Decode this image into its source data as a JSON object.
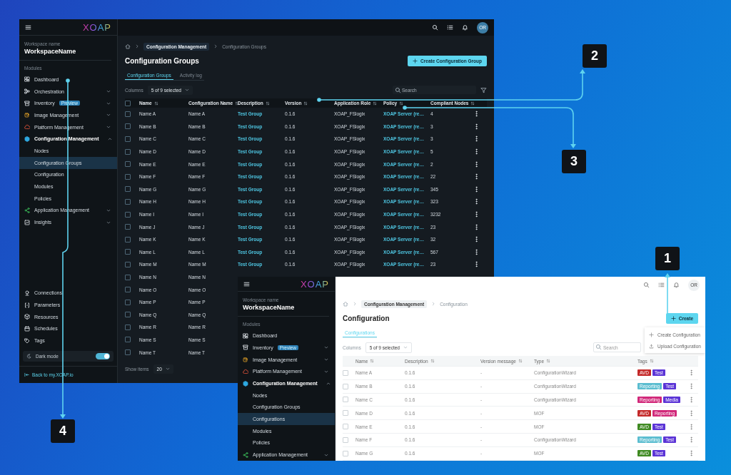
{
  "dark_window": {
    "sidebar": {
      "logo": "XOAP",
      "workspace_label": "Workspace name",
      "workspace_name": "WorkspaceName",
      "modules_label": "Modules",
      "nav": [
        {
          "label": "Dashboard",
          "selected": false
        },
        {
          "label": "Orchestration",
          "selected": false,
          "expanded": false
        },
        {
          "label": "Inventory",
          "selected": false,
          "expanded": false,
          "badge": "Preview"
        },
        {
          "label": "Image Management",
          "selected": false,
          "expanded": false
        },
        {
          "label": "Platform Management",
          "selected": false,
          "expanded": false
        },
        {
          "label": "Configuration Management",
          "selected": false,
          "expanded": true,
          "children": [
            {
              "label": "Nodes",
              "selected": false
            },
            {
              "label": "Configuration Groups",
              "selected": true
            },
            {
              "label": "Configuration",
              "selected": false
            },
            {
              "label": "Modules",
              "selected": false
            },
            {
              "label": "Policies",
              "selected": false
            }
          ]
        },
        {
          "label": "Application Management",
          "selected": false,
          "expanded": false
        },
        {
          "label": "Insights",
          "selected": false,
          "expanded": false
        }
      ],
      "bottom_nav": [
        {
          "label": "Connections"
        },
        {
          "label": "Parameters"
        },
        {
          "label": "Resources"
        },
        {
          "label": "Schedules"
        },
        {
          "label": "Tags"
        }
      ],
      "dark_mode": {
        "label": "Dark mode",
        "on": true
      },
      "back_link": "Back to my.XOAP.io"
    },
    "avatar": "OR",
    "breadcrumb": [
      "Configuration Management",
      "Configuration Groups"
    ],
    "title": "Configuration Groups",
    "create_button": "Create Configuration Group",
    "tabs": [
      {
        "label": "Configuration Groups",
        "selected": true
      },
      {
        "label": "Activity log",
        "selected": false
      }
    ],
    "columns_label": "Columns",
    "columns_select": "5 of 9 selected",
    "search": {
      "placeholder": "Search"
    },
    "select_all_checked": false,
    "columns": [
      "Name",
      "Configuration Name",
      "Description",
      "Version",
      "Application Role",
      "Policy",
      "Compliant Nodes"
    ],
    "rows": [
      {
        "checked": false,
        "name": "Name A",
        "configuration_name": "Name A",
        "description": "Test Group",
        "version": "0.1.6",
        "application_role": "XOAP_FSlogix",
        "policy": "XOAP Server (re…",
        "compliant_nodes": "4"
      },
      {
        "checked": false,
        "name": "Name B",
        "configuration_name": "Name B",
        "description": "Test Group",
        "version": "0.1.6",
        "application_role": "XOAP_FSlogix",
        "policy": "XOAP Server (re…",
        "compliant_nodes": "3"
      },
      {
        "checked": false,
        "name": "Name C",
        "configuration_name": "Name C",
        "description": "Test Group",
        "version": "0.1.6",
        "application_role": "XOAP_FSlogix",
        "policy": "XOAP Server (re…",
        "compliant_nodes": "3"
      },
      {
        "checked": false,
        "name": "Name D",
        "configuration_name": "Name D",
        "description": "Test Group",
        "version": "0.1.6",
        "application_role": "XOAP_FSlogix",
        "policy": "XOAP Server (re…",
        "compliant_nodes": "5"
      },
      {
        "checked": false,
        "name": "Name E",
        "configuration_name": "Name E",
        "description": "Test Group",
        "version": "0.1.6",
        "application_role": "XOAP_FSlogix",
        "policy": "XOAP Server (re…",
        "compliant_nodes": "2"
      },
      {
        "checked": false,
        "name": "Name F",
        "configuration_name": "Name F",
        "description": "Test Group",
        "version": "0.1.6",
        "application_role": "XOAP_FSlogix",
        "policy": "XOAP Server (re…",
        "compliant_nodes": "22"
      },
      {
        "checked": false,
        "name": "Name G",
        "configuration_name": "Name G",
        "description": "Test Group",
        "version": "0.1.6",
        "application_role": "XOAP_FSlogix",
        "policy": "XOAP Server (re…",
        "compliant_nodes": "345"
      },
      {
        "checked": false,
        "name": "Name H",
        "configuration_name": "Name H",
        "description": "Test Group",
        "version": "0.1.6",
        "application_role": "XOAP_FSlogix",
        "policy": "XOAP Server (re…",
        "compliant_nodes": "323"
      },
      {
        "checked": false,
        "name": "Name I",
        "configuration_name": "Name I",
        "description": "Test Group",
        "version": "0.1.6",
        "application_role": "XOAP_FSlogix",
        "policy": "XOAP Server (re…",
        "compliant_nodes": "3232"
      },
      {
        "checked": false,
        "name": "Name J",
        "configuration_name": "Name J",
        "description": "Test Group",
        "version": "0.1.6",
        "application_role": "XOAP_FSlogix",
        "policy": "XOAP Server (re…",
        "compliant_nodes": "23"
      },
      {
        "checked": false,
        "name": "Name K",
        "configuration_name": "Name K",
        "description": "Test Group",
        "version": "0.1.6",
        "application_role": "XOAP_FSlogix",
        "policy": "XOAP Server (re…",
        "compliant_nodes": "32"
      },
      {
        "checked": false,
        "name": "Name L",
        "configuration_name": "Name L",
        "description": "Test Group",
        "version": "0.1.6",
        "application_role": "XOAP_FSlogix",
        "policy": "XOAP Server (re…",
        "compliant_nodes": "567"
      },
      {
        "checked": false,
        "name": "Name M",
        "configuration_name": "Name M",
        "description": "Test Group",
        "version": "0.1.6",
        "application_role": "XOAP_FSlogix",
        "policy": "XOAP Server (re…",
        "compliant_nodes": "23"
      },
      {
        "checked": false,
        "name": "Name N",
        "configuration_name": "Name N"
      },
      {
        "checked": false,
        "name": "Name O",
        "configuration_name": "Name O"
      },
      {
        "checked": false,
        "name": "Name P",
        "configuration_name": "Name P"
      },
      {
        "checked": false,
        "name": "Name Q",
        "configuration_name": "Name Q"
      },
      {
        "checked": false,
        "name": "Name R",
        "configuration_name": "Name R"
      },
      {
        "checked": false,
        "name": "Name S",
        "configuration_name": "Name S"
      },
      {
        "checked": false,
        "name": "Name T",
        "configuration_name": "Name T"
      }
    ],
    "show_items_label": "Show items",
    "show_items_value": "20"
  },
  "light_window": {
    "sidebar": {
      "logo": "XOAP",
      "workspace_label": "Workspace name",
      "workspace_name": "WorkspaceName",
      "modules_label": "Modules",
      "nav": [
        {
          "label": "Dashboard",
          "selected": false
        },
        {
          "label": "Inventory",
          "selected": false,
          "expanded": false,
          "badge": "Preview"
        },
        {
          "label": "Image Management",
          "selected": false,
          "expanded": false
        },
        {
          "label": "Platform Management",
          "selected": false,
          "expanded": false
        },
        {
          "label": "Configuration Management",
          "selected": false,
          "expanded": true,
          "children": [
            {
              "label": "Nodes",
              "selected": false
            },
            {
              "label": "Configuration Groups",
              "selected": false
            },
            {
              "label": "Configurations",
              "selected": true
            },
            {
              "label": "Modules",
              "selected": false
            },
            {
              "label": "Policies",
              "selected": false
            }
          ]
        },
        {
          "label": "Application Management",
          "selected": false,
          "expanded": false
        }
      ]
    },
    "avatar": "OR",
    "breadcrumb": [
      "Configuration Management",
      "Configuration"
    ],
    "title": "Configuration",
    "create_button": "Create",
    "create_menu": [
      "Create Configuration",
      "Upload Configuration"
    ],
    "tabs": [
      {
        "label": "Configurations",
        "selected": true
      }
    ],
    "columns_label": "Columns",
    "columns_select": "5 of 9 selected",
    "search": {
      "placeholder": "Search"
    },
    "columns": [
      "Name",
      "Description",
      "Version message",
      "Type",
      "Tags"
    ],
    "rows": [
      {
        "checked": false,
        "name": "Name A",
        "description": "0.1.6",
        "version_message": "-",
        "type": "ConfigurationWizard",
        "tags": [
          {
            "label": "AVD",
            "color": "#c42a2a"
          },
          {
            "label": "Test",
            "color": "#5b34d6"
          }
        ]
      },
      {
        "checked": false,
        "name": "Name B",
        "description": "0.1.6",
        "version_message": "-",
        "type": "ConfigurationWizard",
        "tags": [
          {
            "label": "Reporting",
            "color": "#5bbdd0"
          },
          {
            "label": "Test",
            "color": "#5b34d6"
          }
        ]
      },
      {
        "checked": false,
        "name": "Name C",
        "description": "0.1.6",
        "version_message": "-",
        "type": "ConfigurationWizard",
        "tags": [
          {
            "label": "Reporting",
            "color": "#d1287a"
          },
          {
            "label": "Media",
            "color": "#5b34d6"
          }
        ]
      },
      {
        "checked": false,
        "name": "Name D",
        "description": "0.1.6",
        "version_message": "-",
        "type": "MOF",
        "tags": [
          {
            "label": "AVD",
            "color": "#c42a2a"
          },
          {
            "label": "Reporting",
            "color": "#d1287a"
          }
        ]
      },
      {
        "checked": false,
        "name": "Name E",
        "description": "0.1.6",
        "version_message": "-",
        "type": "MOF",
        "tags": [
          {
            "label": "AVD",
            "color": "#3f8a22"
          },
          {
            "label": "Test",
            "color": "#5b34d6"
          }
        ]
      },
      {
        "checked": false,
        "name": "Name F",
        "description": "0.1.6",
        "version_message": "-",
        "type": "ConfigurationWizard",
        "tags": [
          {
            "label": "Reporting",
            "color": "#5bbdd0"
          },
          {
            "label": "Test",
            "color": "#5b34d6"
          }
        ]
      },
      {
        "checked": false,
        "name": "Name G",
        "description": "0.1.6",
        "version_message": "-",
        "type": "MOF",
        "tags": [
          {
            "label": "AVD",
            "color": "#3f8a22"
          },
          {
            "label": "Test",
            "color": "#5b34d6"
          }
        ]
      }
    ]
  },
  "callouts": [
    {
      "number": "1"
    },
    {
      "number": "2"
    },
    {
      "number": "3"
    },
    {
      "number": "4"
    }
  ]
}
